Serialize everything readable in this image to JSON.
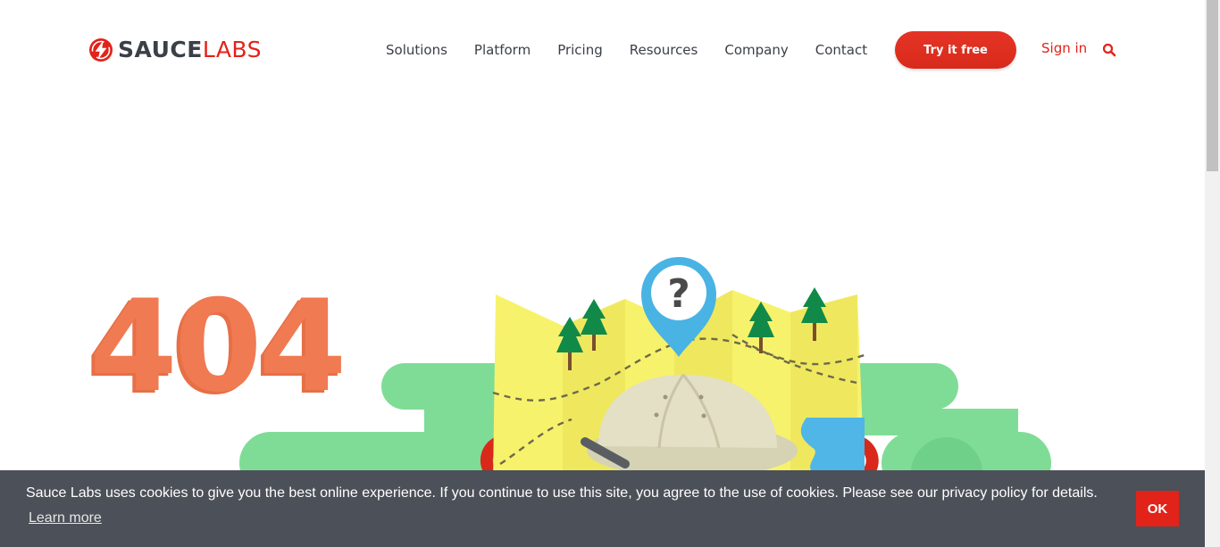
{
  "brand": {
    "name_bold": "SAUCE",
    "name_light": "LABS",
    "accent": "#e2231a",
    "dark": "#3b3f47"
  },
  "nav": {
    "items": [
      {
        "label": "Solutions"
      },
      {
        "label": "Platform"
      },
      {
        "label": "Pricing"
      },
      {
        "label": "Resources"
      },
      {
        "label": "Company"
      },
      {
        "label": "Contact"
      }
    ],
    "cta_label": "Try it free",
    "signin_label": "Sign in",
    "search_icon": "search-icon"
  },
  "hero": {
    "error_code": "404",
    "color": "#f07a52",
    "illustration": "explorer-with-map-and-question-pin"
  },
  "cookie": {
    "message": "Sauce Labs uses cookies to give you the best online experience. If you continue to use this site, you agree to the use of cookies. Please see our privacy policy for details.",
    "learn_more": "Learn more",
    "ok_label": "OK",
    "background": "#4c5058"
  }
}
